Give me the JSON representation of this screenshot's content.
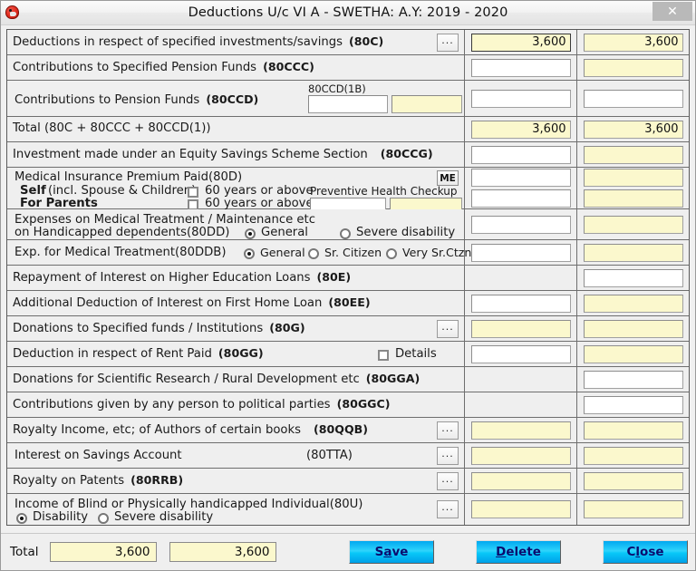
{
  "window": {
    "title": "Deductions U/c VI A - SWETHA: A.Y: 2019 - 2020",
    "close_label": "✕",
    "app_icon": "app-logo-icon"
  },
  "rows": [
    {
      "id": "80c",
      "label": "Deductions in respect of specified investments/savings",
      "section": "(80C)",
      "dots": "...",
      "left_value": "3,600",
      "right_value": "3,600"
    },
    {
      "id": "80ccc",
      "label": "Contributions to Specified Pension Funds",
      "section": "(80CCC)",
      "left_value": "",
      "right_value": ""
    },
    {
      "id": "80ccd",
      "label": "Contributions to Pension Funds",
      "section": "(80CCD)",
      "sub_caption": "80CCD(1B)",
      "sub_left_value": "",
      "sub_right_value": "",
      "left_value": "",
      "right_value": ""
    },
    {
      "id": "total_80c",
      "label": "Total (80C + 80CCC + 80CCD(1))",
      "section": "",
      "left_value": "3,600",
      "right_value": "3,600"
    },
    {
      "id": "80ccg",
      "label": "Investment made under an Equity Savings Scheme Section",
      "section": "(80CCG)",
      "left_value": "",
      "right_value": ""
    },
    {
      "id": "80d",
      "label": "Medical Insurance Premium Paid",
      "section": "(80D)",
      "me_button": "ME",
      "self_label_bold": "Self",
      "self_label_rest": "(incl. Spouse & Children)",
      "self_age_label": "60 years or above",
      "parents_label": "For Parents",
      "parents_age_label": "60 years or above",
      "preventive_caption": "Preventive Health Checkup",
      "preventive_left_value": "",
      "preventive_right_value": "",
      "left_value_1": "",
      "left_value_2": "",
      "right_value_1": "",
      "right_value_2": ""
    },
    {
      "id": "80dd",
      "label_line1": "Expenses on Medical Treatment / Maintenance etc",
      "label_line2": "on Handicapped dependents",
      "section": "(80DD)",
      "radio_general": "General",
      "radio_severe": "Severe disability",
      "selected": "General",
      "left_value": "",
      "right_value": ""
    },
    {
      "id": "80ddb",
      "label": "Exp. for Medical Treatment",
      "section": "(80DDB)",
      "radio_general": "General",
      "radio_senior": "Sr. Citizen",
      "radio_very_senior": "Very Sr.Ctzn",
      "selected": "General",
      "left_value": "",
      "right_value": ""
    },
    {
      "id": "80e",
      "label": "Repayment of Interest on Higher Education Loans",
      "section": "(80E)",
      "left_value": null,
      "right_value": ""
    },
    {
      "id": "80ee",
      "label": "Additional Deduction of Interest on First Home Loan",
      "section": "(80EE)",
      "left_value": "",
      "right_value": ""
    },
    {
      "id": "80g",
      "label": "Donations to Specified funds / Institutions",
      "section": "(80G)",
      "dots": "...",
      "left_value": "",
      "right_value": ""
    },
    {
      "id": "80gg",
      "label": "Deduction in respect of Rent Paid",
      "section": "(80GG)",
      "details_label": "Details",
      "left_value": "",
      "right_value": ""
    },
    {
      "id": "80gga",
      "label": "Donations for Scientific Research / Rural Development etc",
      "section": "(80GGA)",
      "left_value": null,
      "right_value": ""
    },
    {
      "id": "80ggc",
      "label": "Contributions given by any person to political parties",
      "section": "(80GGC)",
      "left_value": null,
      "right_value": ""
    },
    {
      "id": "80qqb",
      "label": "Royalty Income, etc; of Authors of certain books",
      "section": "(80QQB)",
      "dots": "...",
      "left_value": "",
      "right_value": ""
    },
    {
      "id": "80tta",
      "label": "Interest on Savings Account",
      "section": "(80TTA)",
      "dots": "...",
      "left_value": "",
      "right_value": ""
    },
    {
      "id": "80rrb",
      "label": "Royalty on Patents",
      "section": "(80RRB)",
      "dots": "...",
      "left_value": "",
      "right_value": ""
    },
    {
      "id": "80u",
      "label": "Income of Blind or Physically handicapped Individual",
      "section": "(80U)",
      "dots": "...",
      "radio_disability": "Disability",
      "radio_severe": "Severe disability",
      "selected": "Disability",
      "left_value": "",
      "right_value": ""
    }
  ],
  "footer": {
    "total_label": "Total",
    "total_left": "3,600",
    "total_right": "3,600",
    "save": {
      "pre": "S",
      "accel": "a",
      "post": "ve"
    },
    "delete": {
      "pre": "",
      "accel": "D",
      "post": "elete"
    },
    "close": {
      "pre": "C",
      "accel": "l",
      "post": "ose"
    }
  },
  "colors": {
    "field_yellow": "#fbf8cd",
    "field_white": "#ffffff",
    "button_cyan": "#2fd4fb",
    "button_blue": "#00a0e8",
    "button_text": "#0b0b6e",
    "grid_line": "#6e6e6e",
    "panel_bg": "#efefef"
  }
}
